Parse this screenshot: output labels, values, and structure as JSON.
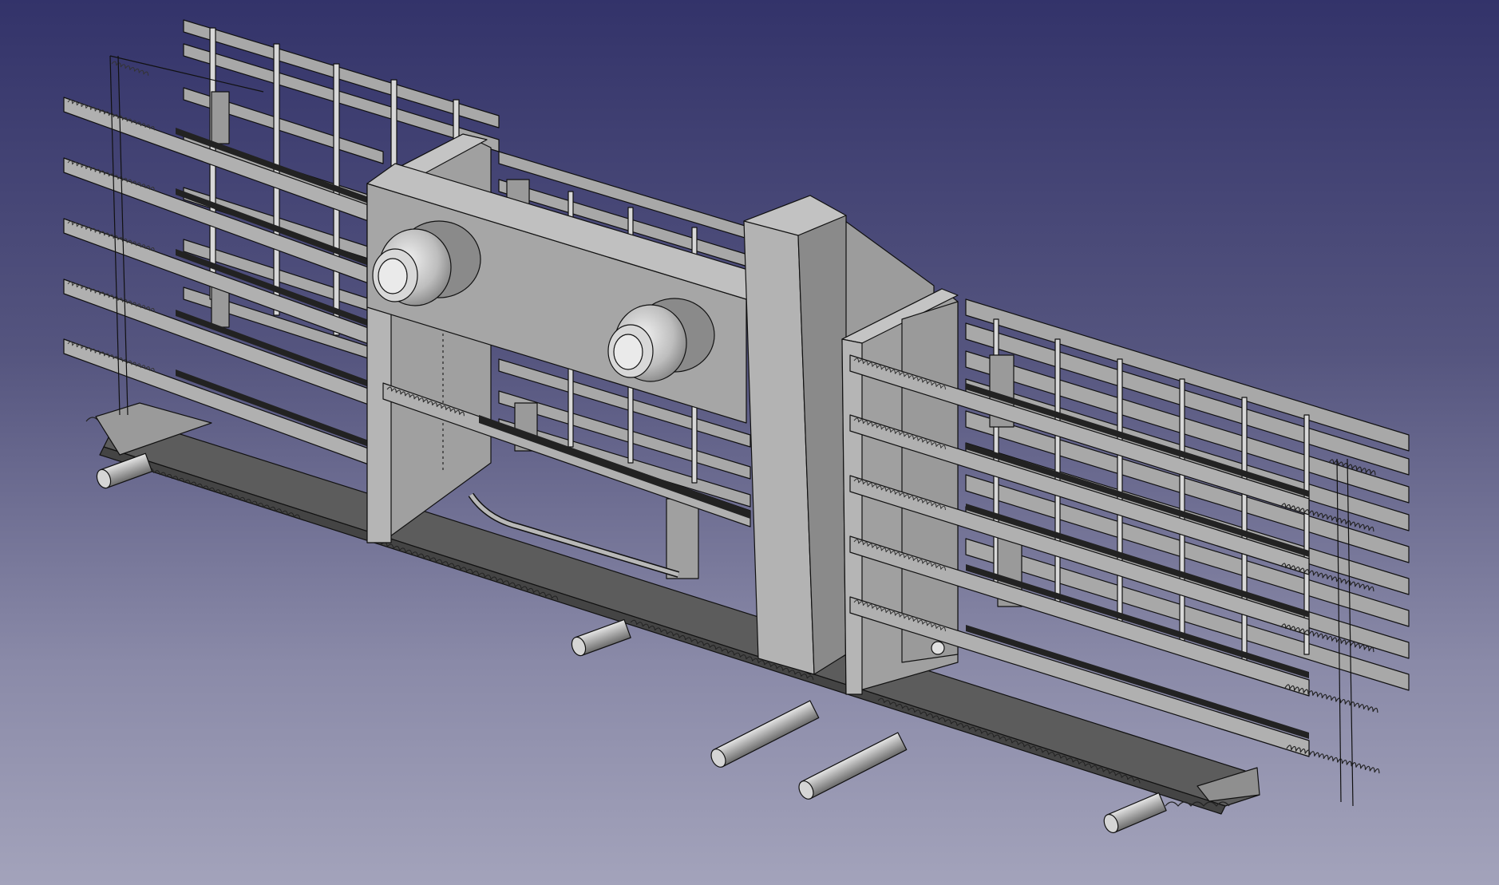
{
  "viewport": {
    "background_top": "#33336a",
    "background_bottom": "#a3a3bb"
  },
  "model": {
    "face_light": "#b8b8b8",
    "face_mid": "#a2a2a2",
    "face_dark": "#5a5a5a",
    "edge": "#111111"
  }
}
